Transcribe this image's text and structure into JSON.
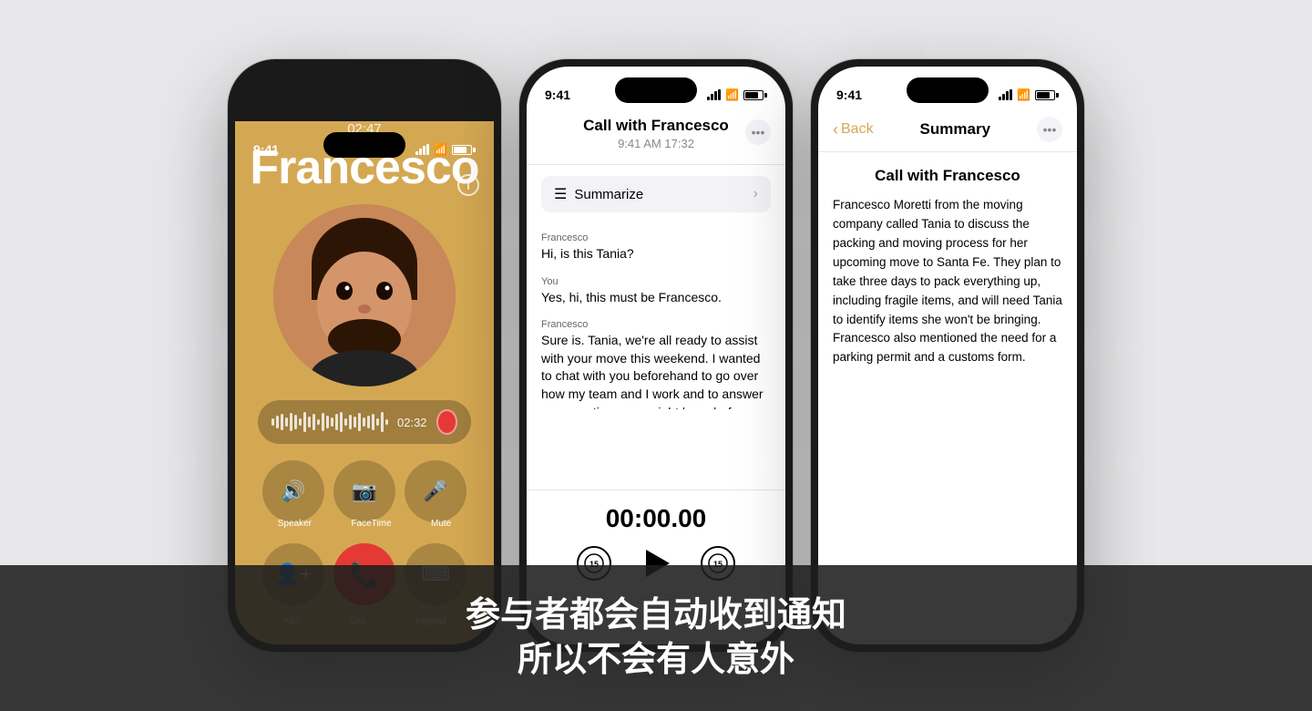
{
  "background": "#e8e8ea",
  "phone1": {
    "statusTime": "9:41",
    "callTimer": "02:47",
    "callerName": "Francesco",
    "waveformTime": "02:32",
    "controls": [
      {
        "icon": "🔊",
        "label": "Speaker"
      },
      {
        "icon": "📷",
        "label": "FaceTime"
      },
      {
        "icon": "🎤",
        "label": "Mute"
      }
    ],
    "bottomControls": [
      {
        "icon": "👤",
        "label": "Add"
      },
      {
        "icon": "📞",
        "label": "End",
        "isEnd": true
      },
      {
        "icon": "⌨",
        "label": "Keypad"
      }
    ]
  },
  "phone2": {
    "statusTime": "9:41",
    "title": "Call with Francesco",
    "subtitle": "9:41 AM  17:32",
    "summarizeLabel": "Summarize",
    "messages": [
      {
        "sender": "Francesco",
        "text": "Hi, is this Tania?"
      },
      {
        "sender": "You",
        "text": "Yes, hi, this must be Francesco."
      },
      {
        "sender": "Francesco",
        "text": "Sure is. Tania, we're all ready to assist with your move this weekend. I wanted to chat with you beforehand to go over how my team and I work and to answer any questions you might have before we arrive Saturday"
      }
    ],
    "playbackTime": "00:00.00",
    "skipBack": "15",
    "skipForward": "15"
  },
  "phone3": {
    "statusTime": "9:41",
    "backLabel": "Back",
    "navTitle": "Summary",
    "callTitle": "Call with Francesco",
    "summaryText": "Francesco Moretti from the moving company called Tania to discuss the packing and moving process for her upcoming move to Santa Fe. They plan to take three days to pack everything up, including fragile items, and will need Tania to identify items she won't be bringing. Francesco also mentioned the need for a parking permit and a customs form."
  },
  "subtitles": {
    "line1": "参与者都会自动收到通知",
    "line2": "所以不会有人意外"
  }
}
